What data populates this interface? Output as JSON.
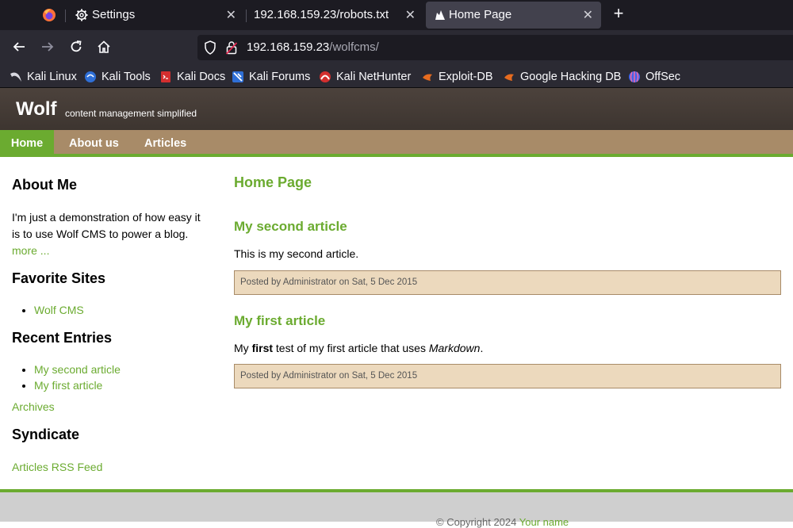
{
  "browser": {
    "tabs": [
      {
        "label": "Settings",
        "icon": "gear-icon",
        "active": false
      },
      {
        "label": "192.168.159.23/robots.txt",
        "icon": "",
        "active": false
      },
      {
        "label": "Home Page",
        "icon": "wolf-icon",
        "active": true
      }
    ],
    "close_glyph": "✕",
    "new_tab_glyph": "+",
    "url": {
      "host": "192.168.159.23",
      "path": "/wolfcms/"
    },
    "bookmarks": [
      {
        "label": "Kali Linux",
        "icon": "kali-dragon-icon"
      },
      {
        "label": "Kali Tools",
        "icon": "kali-tools-icon"
      },
      {
        "label": "Kali Docs",
        "icon": "kali-docs-icon"
      },
      {
        "label": "Kali Forums",
        "icon": "kali-forums-icon"
      },
      {
        "label": "Kali NetHunter",
        "icon": "nethunter-icon"
      },
      {
        "label": "Exploit-DB",
        "icon": "exploit-db-icon"
      },
      {
        "label": "Google Hacking DB",
        "icon": "ghdb-icon"
      },
      {
        "label": "OffSec",
        "icon": "offsec-icon"
      }
    ]
  },
  "site": {
    "title": "Wolf",
    "slogan": "content management simplified",
    "nav": [
      "Home",
      "About us",
      "Articles"
    ],
    "sidebar": {
      "about_heading": "About Me",
      "about_line1": "I'm just a demonstration of how easy it",
      "about_line2": "is to use Wolf CMS to power a blog.",
      "more_link": "more ...",
      "favorites_heading": "Favorite Sites",
      "favorites": [
        "Wolf CMS"
      ],
      "recent_heading": "Recent Entries",
      "recent": [
        "My second article",
        "My first article"
      ],
      "archives_link": "Archives",
      "syndicate_heading": "Syndicate",
      "rss_link": "Articles RSS Feed"
    },
    "main": {
      "page_title": "Home Page",
      "articles": [
        {
          "title": "My second article",
          "body": "This is my second article.",
          "meta": "Posted by Administrator on Sat, 5 Dec 2015"
        },
        {
          "title": "My first article",
          "body_before": "My ",
          "body_bold": "first",
          "body_middle": " test of my first article that uses ",
          "body_italic": "Markdown",
          "body_after": ".",
          "meta": "Posted by Administrator on Sat, 5 Dec 2015"
        }
      ]
    },
    "footer": {
      "copyright": "© Copyright 2024 ",
      "link": "Your name"
    }
  },
  "colors": {
    "accent_green": "#6bab30",
    "nav_tan": "#a88b68",
    "header_brown": "#4c423c",
    "meta_bg": "#ecd9bd",
    "chrome_dark": "#1c1b22"
  }
}
